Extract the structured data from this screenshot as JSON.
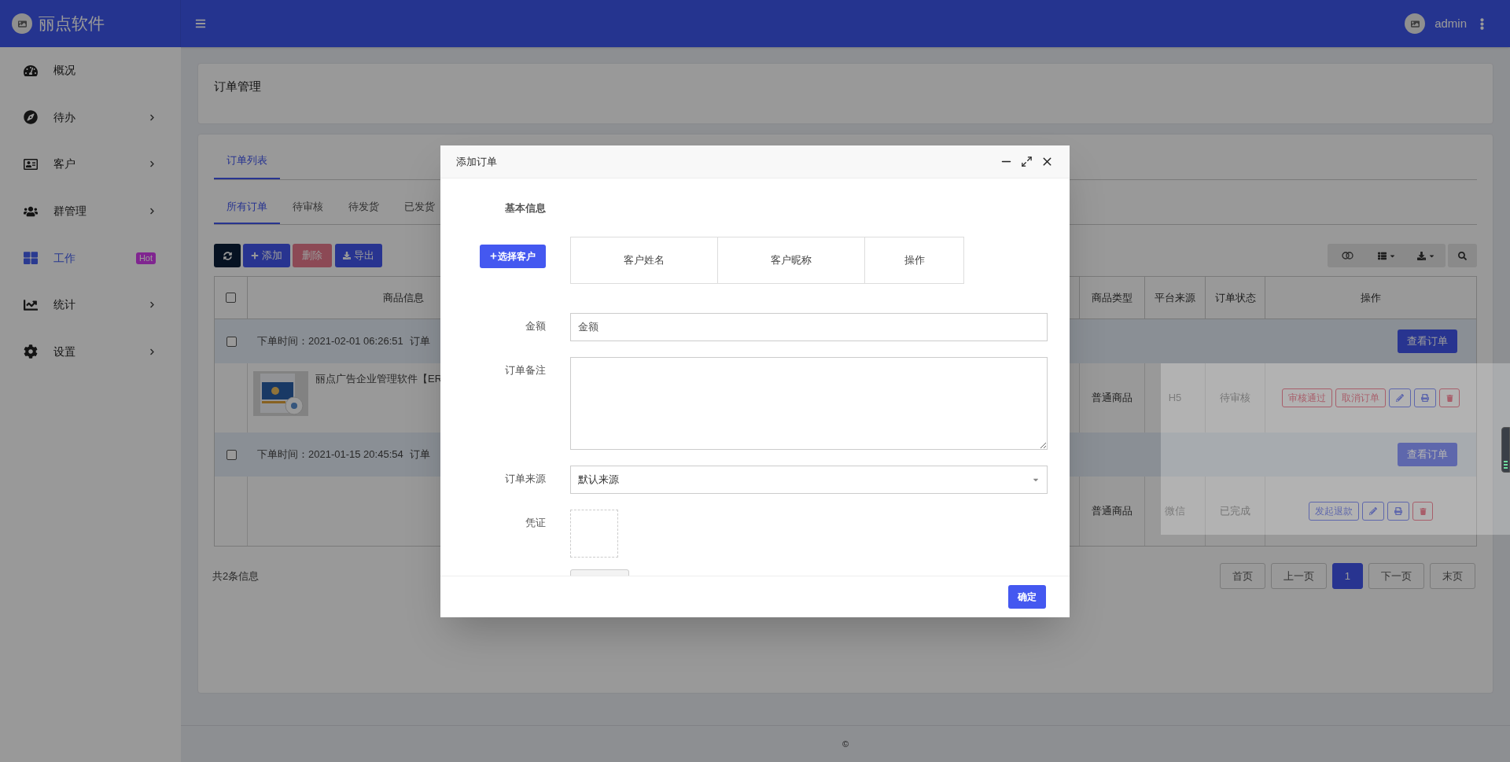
{
  "app": {
    "brand": "丽点软件",
    "user": "admin"
  },
  "sidebar": {
    "items": [
      {
        "label": "概况",
        "expandable": false,
        "selected": false
      },
      {
        "label": "待办",
        "expandable": true,
        "selected": false
      },
      {
        "label": "客户",
        "expandable": true,
        "selected": false
      },
      {
        "label": "群管理",
        "expandable": true,
        "selected": false
      },
      {
        "label": "工作",
        "badge": "Hot",
        "expandable": false,
        "selected": true
      },
      {
        "label": "统计",
        "expandable": true,
        "selected": false
      },
      {
        "label": "设置",
        "expandable": true,
        "selected": false
      }
    ]
  },
  "page_title": "订单管理",
  "tabs": [
    {
      "label": "订单列表",
      "selected": true
    }
  ],
  "status_tabs": [
    {
      "label": "所有订单",
      "selected": true
    },
    {
      "label": "待审核",
      "selected": false
    },
    {
      "label": "待发货",
      "selected": false
    },
    {
      "label": "已发货",
      "selected": false
    }
  ],
  "toolbar": [
    {
      "kind": "refresh"
    },
    {
      "kind": "add",
      "label": "添加",
      "disabled": false
    },
    {
      "kind": "delete",
      "label": "删除",
      "disabled": true
    },
    {
      "kind": "export",
      "label": "导出",
      "disabled": false
    }
  ],
  "table": {
    "select_all": {
      "checked": false
    },
    "columns": {
      "goods": "商品信息",
      "type": "商品类型",
      "source": "平台来源",
      "status": "订单状态",
      "actions": "操作"
    },
    "orders": [
      {
        "checked": false,
        "time": "下单时间：2021-02-01 06:26:51",
        "tail": "订单",
        "view": "查看订单",
        "product": "丽点广告企业管理软件【ER",
        "type": "普通商品",
        "source": "H5",
        "status": "待审核",
        "actions": [
          {
            "kind": "danger",
            "label": "审核通过"
          },
          {
            "kind": "danger",
            "label": "取消订单"
          },
          {
            "kind": "edit"
          },
          {
            "kind": "print"
          },
          {
            "kind": "delete"
          }
        ]
      },
      {
        "checked": false,
        "time": "下单时间：2021-01-15 20:45:54",
        "tail": "订单",
        "view": "查看订单",
        "type": "普通商品",
        "source": "微信",
        "status": "已完成",
        "actions": [
          {
            "kind": "primary",
            "label": "发起退款"
          },
          {
            "kind": "edit"
          },
          {
            "kind": "print"
          },
          {
            "kind": "delete"
          }
        ]
      }
    ]
  },
  "count": "共2条信息",
  "pagination": [
    {
      "label": "首页",
      "selected": false
    },
    {
      "label": "上一页",
      "selected": false
    },
    {
      "label": "1",
      "selected": true
    },
    {
      "label": "下一页",
      "selected": false
    },
    {
      "label": "末页",
      "selected": false
    }
  ],
  "copyright": "©",
  "dialog": {
    "title": "添加订单",
    "section": "基本信息",
    "select_customer": "选择客户",
    "customer_columns": [
      "客户姓名",
      "客户昵称",
      "操作"
    ],
    "fields": [
      {
        "kind": "input",
        "label": "金额",
        "placeholder": "金额"
      },
      {
        "kind": "textarea",
        "label": "订单备注"
      },
      {
        "kind": "select",
        "label": "订单来源",
        "value": "默认来源"
      },
      {
        "kind": "upload",
        "label": "凭证"
      }
    ],
    "confirm": "确定"
  }
}
